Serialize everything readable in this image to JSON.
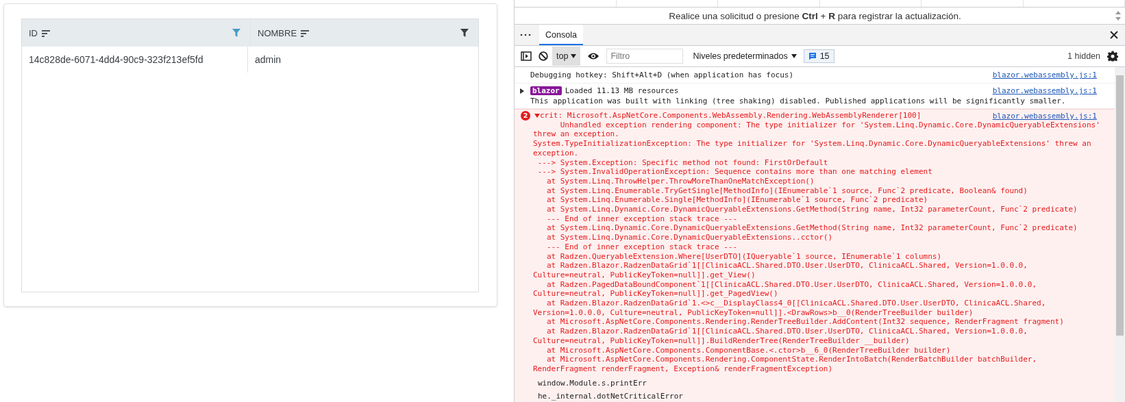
{
  "grid": {
    "columns": [
      {
        "title": "ID",
        "filter_active": true
      },
      {
        "title": "NOMBRE",
        "filter_active": false
      }
    ],
    "rows": [
      [
        "14c828de-6071-4dd4-90c9-323f213ef5fd",
        "admin"
      ]
    ]
  },
  "devtools": {
    "request_hint": "Realice una solicitud o presione **Ctrl** + **R** para registrar la actualización.",
    "tabs": [
      {
        "label": "Consola",
        "selected": true
      }
    ],
    "toolbar": {
      "context": "top",
      "filter": {
        "placeholder": "Filtro"
      },
      "levels": "Niveles predeterminados",
      "message_count": "15",
      "hidden": "1 hidden"
    },
    "messages": [
      {
        "kind": "log",
        "lines": [
          "Debugging hotkey: Shift+Alt+D (when application has focus)"
        ],
        "source": "blazor.webassembly.js:1"
      },
      {
        "kind": "group",
        "expanded": false,
        "badge": "blazor",
        "lines": [
          "Loaded 11.13 MB resources",
          "This application was built with linking (tree shaking) disabled. Published applications will be significantly smaller."
        ],
        "source": "blazor.webassembly.js:1"
      },
      {
        "kind": "error",
        "count": "2",
        "expanded": true,
        "source": "blazor.webassembly.js:1",
        "lines": [
          "crit: Microsoft.AspNetCore.Components.WebAssembly.Rendering.WebAssemblyRenderer[100]",
          "      Unhandled exception rendering component: The type initializer for 'System.Linq.Dynamic.Core.DynamicQueryableExtensions' threw an exception.",
          "System.TypeInitializationException: The type initializer for 'System.Linq.Dynamic.Core.DynamicQueryableExtensions' threw an exception.",
          " ---> System.Exception: Specific method not found: FirstOrDefault",
          " ---> System.InvalidOperationException: Sequence contains more than one matching element",
          "   at System.Linq.ThrowHelper.ThrowMoreThanOneMatchException()",
          "   at System.Linq.Enumerable.TryGetSingle[MethodInfo](IEnumerable`1 source, Func`2 predicate, Boolean& found)",
          "   at System.Linq.Enumerable.Single[MethodInfo](IEnumerable`1 source, Func`2 predicate)",
          "   at System.Linq.Dynamic.Core.DynamicQueryableExtensions.GetMethod(String name, Int32 parameterCount, Func`2 predicate)",
          "   --- End of inner exception stack trace ---",
          "   at System.Linq.Dynamic.Core.DynamicQueryableExtensions.GetMethod(String name, Int32 parameterCount, Func`2 predicate)",
          "   at System.Linq.Dynamic.Core.DynamicQueryableExtensions..cctor()",
          "   --- End of inner exception stack trace ---",
          "   at Radzen.QueryableExtension.Where[UserDTO](IQueryable`1 source, IEnumerable`1 columns)",
          "   at Radzen.Blazor.RadzenDataGrid`1[[ClinicaACL.Shared.DTO.User.UserDTO, ClinicaACL.Shared, Version=1.0.0.0, Culture=neutral, PublicKeyToken=null]].get_View()",
          "   at Radzen.PagedDataBoundComponent`1[[ClinicaACL.Shared.DTO.User.UserDTO, ClinicaACL.Shared, Version=1.0.0.0, Culture=neutral, PublicKeyToken=null]].get_PagedView()",
          "   at Radzen.Blazor.RadzenDataGrid`1.<>c__DisplayClass4_0[[ClinicaACL.Shared.DTO.User.UserDTO, ClinicaACL.Shared, Version=1.0.0.0, Culture=neutral, PublicKeyToken=null]].<DrawRows>b__0(RenderTreeBuilder builder)",
          "   at Microsoft.AspNetCore.Components.Rendering.RenderTreeBuilder.AddContent(Int32 sequence, RenderFragment fragment)",
          "   at Radzen.Blazor.RadzenDataGrid`1[[ClinicaACL.Shared.DTO.User.UserDTO, ClinicaACL.Shared, Version=1.0.0.0, Culture=neutral, PublicKeyToken=null]].BuildRenderTree(RenderTreeBuilder __builder)",
          "   at Microsoft.AspNetCore.Components.ComponentBase.<.ctor>b__6_0(RenderTreeBuilder builder)",
          "   at Microsoft.AspNetCore.Components.Rendering.ComponentState.RenderIntoBatch(RenderBatchBuilder batchBuilder, RenderFragment renderFragment, Exception& renderFragmentException)"
        ],
        "stack": [
          "window.Module.s.printErr",
          "he._internal.dotNetCriticalError"
        ]
      }
    ]
  }
}
